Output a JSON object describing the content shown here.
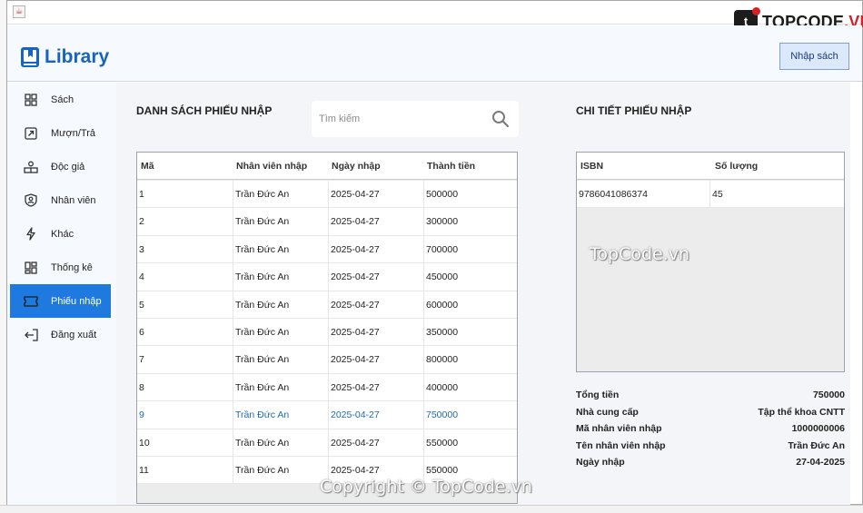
{
  "watermark": {
    "brand_prefix": "TOPCODE",
    "brand_suffix": ".VN",
    "center": "TopCode.vn",
    "bottom": "Copyright © TopCode.vn",
    "badge": "t"
  },
  "app": {
    "title": "Library",
    "import_button": "Nhập sách",
    "accent": "#1f7ae0",
    "brand_color": "#1565c0"
  },
  "sidebar": {
    "items": [
      {
        "label": "Sách",
        "icon": "grid-icon"
      },
      {
        "label": "Mượn/Trả",
        "icon": "arrow-box-icon"
      },
      {
        "label": "Độc giả",
        "icon": "users-icon"
      },
      {
        "label": "Nhân viên",
        "icon": "badge-icon"
      },
      {
        "label": "Khác",
        "icon": "bolt-icon"
      },
      {
        "label": "Thống kê",
        "icon": "dashboard-icon"
      },
      {
        "label": "Phiếu nhập",
        "icon": "ticket-icon",
        "active": true
      },
      {
        "label": "Đăng xuất",
        "icon": "logout-icon"
      }
    ]
  },
  "left_panel": {
    "title": "DANH SÁCH PHIẾU NHẬP",
    "search_placeholder": "Tìm kiếm",
    "columns": [
      "Mã",
      "Nhân viên nhập",
      "Ngày nhập",
      "Thành tiền"
    ],
    "rows": [
      [
        "1",
        "Trần Đức An",
        "2025-04-27",
        "500000"
      ],
      [
        "2",
        "Trần Đức An",
        "2025-04-27",
        "300000"
      ],
      [
        "3",
        "Trần Đức An",
        "2025-04-27",
        "700000"
      ],
      [
        "4",
        "Trần Đức An",
        "2025-04-27",
        "450000"
      ],
      [
        "5",
        "Trần Đức An",
        "2025-04-27",
        "600000"
      ],
      [
        "6",
        "Trần Đức An",
        "2025-04-27",
        "350000"
      ],
      [
        "7",
        "Trần Đức An",
        "2025-04-27",
        "800000"
      ],
      [
        "8",
        "Trần Đức An",
        "2025-04-27",
        "400000"
      ],
      [
        "9",
        "Trần Đức An",
        "2025-04-27",
        "750000"
      ],
      [
        "10",
        "Trần Đức An",
        "2025-04-27",
        "550000"
      ],
      [
        "11",
        "Trần Đức An",
        "2025-04-27",
        "550000"
      ]
    ],
    "selected_row": 8
  },
  "right_panel": {
    "title": "CHI TIẾT PHIẾU NHẬP",
    "columns": [
      "ISBN",
      "Số lượng"
    ],
    "rows": [
      [
        "9786041086374",
        "45"
      ]
    ],
    "summary": [
      {
        "label": "Tổng tiền",
        "value": "750000"
      },
      {
        "label": "Nhà cung cấp",
        "value": "Tập thể khoa CNTT"
      },
      {
        "label": "Mã nhân viên nhập",
        "value": "1000000006"
      },
      {
        "label": "Tên nhân viên nhập",
        "value": "Trần Đức An"
      },
      {
        "label": "Ngày nhập",
        "value": "27-04-2025"
      }
    ]
  }
}
